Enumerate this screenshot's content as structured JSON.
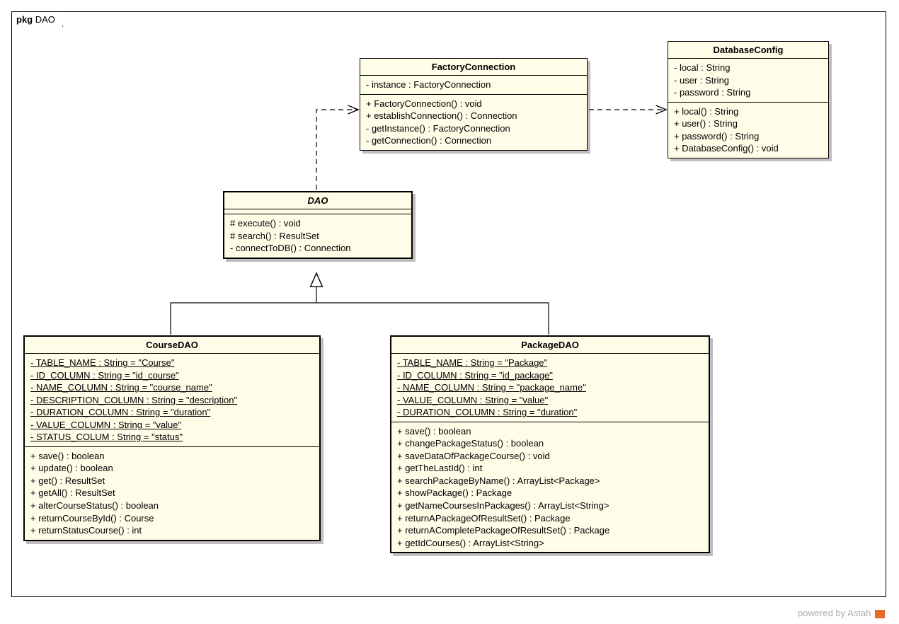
{
  "package": {
    "label_prefix": "pkg",
    "label_name": "DAO"
  },
  "footer": {
    "text": "powered by Astah"
  },
  "classes": {
    "factoryConnection": {
      "name": "FactoryConnection",
      "attrs": [
        {
          "text": "- instance : FactoryConnection"
        }
      ],
      "ops": [
        {
          "text": "+ FactoryConnection() : void"
        },
        {
          "text": "+ establishConnection() : Connection"
        },
        {
          "text": "- getInstance() : FactoryConnection"
        },
        {
          "text": "- getConnection() : Connection"
        }
      ]
    },
    "databaseConfig": {
      "name": "DatabaseConfig",
      "attrs": [
        {
          "text": "- local : String"
        },
        {
          "text": "- user : String"
        },
        {
          "text": "- password : String"
        }
      ],
      "ops": [
        {
          "text": "+ local() : String"
        },
        {
          "text": "+ user() : String"
        },
        {
          "text": "+ password() : String"
        },
        {
          "text": "+ DatabaseConfig() : void"
        }
      ]
    },
    "dao": {
      "name": "DAO",
      "ops": [
        {
          "text": "# execute() : void"
        },
        {
          "text": "# search() : ResultSet"
        },
        {
          "text": "- connectToDB() : Connection"
        }
      ]
    },
    "courseDAO": {
      "name": "CourseDAO",
      "attrs": [
        {
          "text": "- TABLE_NAME : String = \"Course\"",
          "static": true
        },
        {
          "text": "- ID_COLUMN : String = \"id_course\"",
          "static": true
        },
        {
          "text": "- NAME_COLUMN : String = \"course_name\"",
          "static": true
        },
        {
          "text": "- DESCRIPTION_COLUMN : String = \"description\"",
          "static": true
        },
        {
          "text": "- DURATION_COLUMN : String = \"duration\"",
          "static": true
        },
        {
          "text": "- VALUE_COLUMN : String = \"value\"",
          "static": true
        },
        {
          "text": "- STATUS_COLUM : String = \"status\"",
          "static": true
        }
      ],
      "ops": [
        {
          "text": "+ save() : boolean"
        },
        {
          "text": "+ update() : boolean"
        },
        {
          "text": "+ get() : ResultSet"
        },
        {
          "text": "+ getAll() : ResultSet"
        },
        {
          "text": "+ alterCourseStatus() : boolean"
        },
        {
          "text": "+ returnCourseById() : Course"
        },
        {
          "text": "+ returnStatusCourse() : int"
        }
      ]
    },
    "packageDAO": {
      "name": "PackageDAO",
      "attrs": [
        {
          "text": "- TABLE_NAME : String = \"Package\"",
          "static": true
        },
        {
          "text": "- ID_COLUMN : String = \"id_package\"",
          "static": true
        },
        {
          "text": "- NAME_COLUMN : String = \"package_name\"",
          "static": true
        },
        {
          "text": "- VALUE_COLUMN : String = \"value\"",
          "static": true
        },
        {
          "text": "- DURATION_COLUMN : String = \"duration\"",
          "static": true
        }
      ],
      "ops": [
        {
          "text": "+ save() : boolean"
        },
        {
          "text": "+ changePackageStatus() : boolean"
        },
        {
          "text": "+ saveDataOfPackageCourse() : void"
        },
        {
          "text": "+ getTheLastId() : int"
        },
        {
          "text": "+ searchPackageByName() : ArrayList<Package>"
        },
        {
          "text": "+ showPackage() : Package"
        },
        {
          "text": "+ getNameCoursesInPackages() : ArrayList<String>"
        },
        {
          "text": "+ returnAPackageOfResultSet() : Package"
        },
        {
          "text": "+ returnACompletePackageOfResultSet() : Package"
        },
        {
          "text": "+ getIdCourses() : ArrayList<String>"
        }
      ]
    }
  }
}
